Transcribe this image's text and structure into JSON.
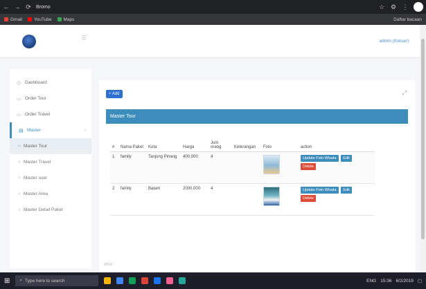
{
  "browser": {
    "tab_title": "Bromo",
    "url": "",
    "bookmarks": [
      "Gmail",
      "YouTube",
      "Maps"
    ],
    "reading_list": "Daftar bacaan"
  },
  "navbar": {
    "logout_label": "admin (Keluar)"
  },
  "sidebar": {
    "items": [
      {
        "label": "Dashboard",
        "icon": "dashboard-icon"
      },
      {
        "label": "Order Tour",
        "icon": "cart-icon"
      },
      {
        "label": "Order Travel",
        "icon": "cart-icon"
      },
      {
        "label": "Master",
        "icon": "database-icon"
      }
    ],
    "sub_items": [
      {
        "label": "Master Tour"
      },
      {
        "label": "Master Travel"
      },
      {
        "label": "Master user"
      },
      {
        "label": "Master Area"
      },
      {
        "label": "Master Detail Paket"
      }
    ]
  },
  "card": {
    "add_label": "+ Add",
    "panel_title": "Master Tour"
  },
  "table": {
    "headers": [
      "#",
      "Nama Paket",
      "Kota",
      "Harga",
      "Jum orang",
      "Keterangan",
      "Foto",
      "action"
    ],
    "rows": [
      {
        "no": "1",
        "paket": "family",
        "kota": "Tanjung Pinang",
        "harga": "400.000",
        "jumlah": "4",
        "keterangan": ""
      },
      {
        "no": "2",
        "paket": "family",
        "kota": "Batam",
        "harga": "2000.000",
        "jumlah": "4",
        "keterangan": ""
      }
    ],
    "action_detail": "Update Foto Wisata",
    "action_edit": "Edit",
    "action_delete": "Delete"
  },
  "footer": {
    "text": "2019"
  },
  "taskbar": {
    "search_placeholder": "Type here to search",
    "lang": "ENG",
    "time": "15:36",
    "date": "6/2/2019"
  }
}
